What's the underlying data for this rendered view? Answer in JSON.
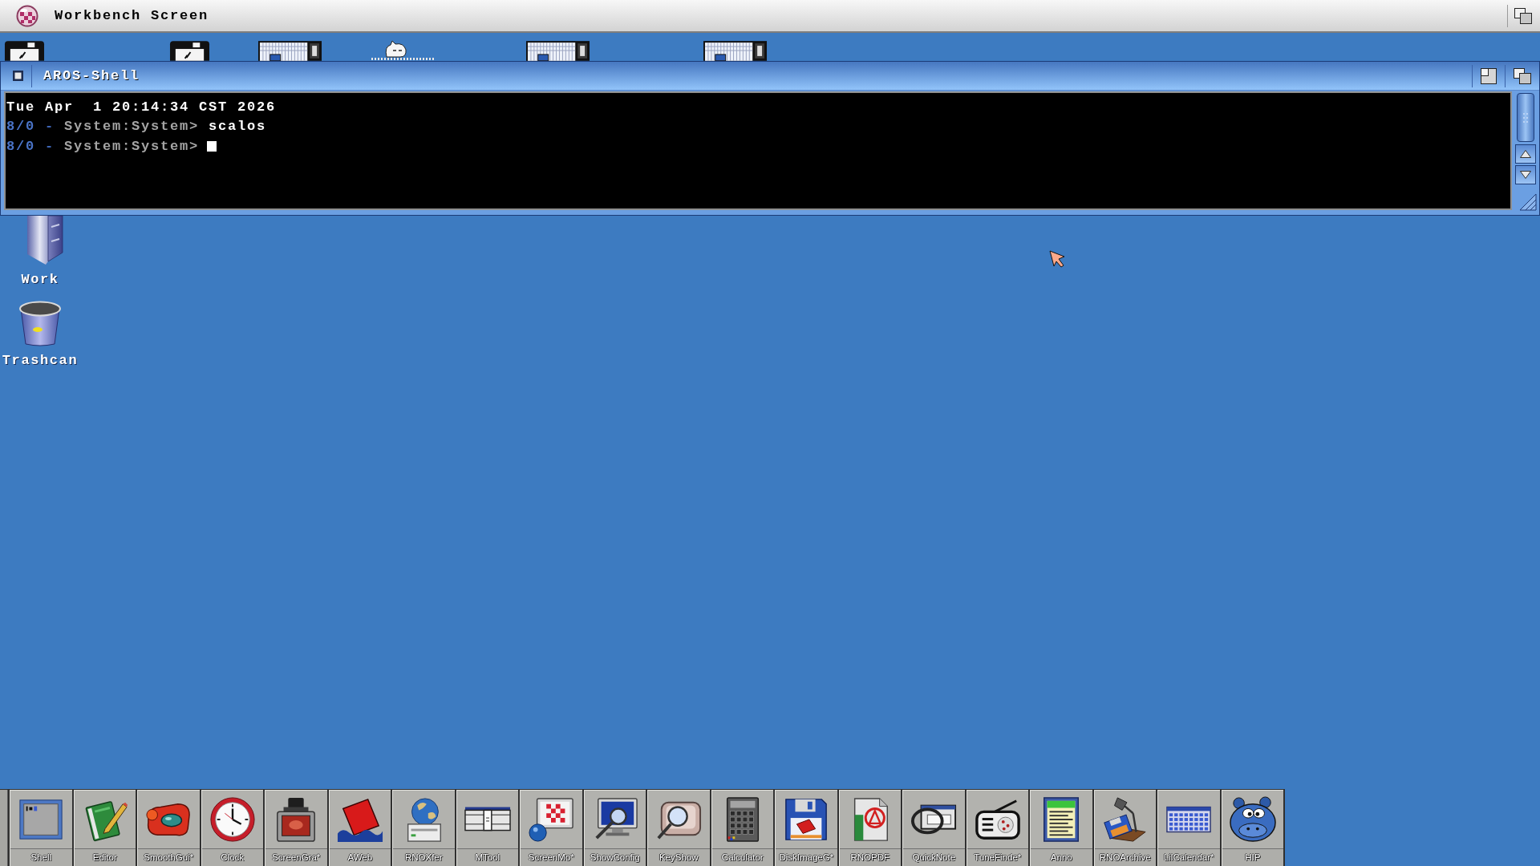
{
  "screen_title_bar": {
    "title": "Workbench Screen"
  },
  "partially_hidden_icons": [
    {
      "kind": "floppy"
    },
    {
      "kind": "floppy"
    },
    {
      "kind": "window"
    },
    {
      "kind": "cat"
    },
    {
      "kind": "window"
    },
    {
      "kind": "window"
    }
  ],
  "shell_window": {
    "title": "AROS-Shell",
    "lines": [
      {
        "segments": [
          {
            "kind": "output",
            "text": "Tue Apr  1 20:14:34 CST 2026"
          }
        ],
        "cursor": false
      },
      {
        "segments": [
          {
            "kind": "job",
            "text": "8/0"
          },
          {
            "kind": "separator",
            "text": "-"
          },
          {
            "kind": "path",
            "text": "System:System>"
          },
          {
            "kind": "command",
            "text": "scalos"
          }
        ],
        "cursor": false
      },
      {
        "segments": [
          {
            "kind": "job",
            "text": "8/0"
          },
          {
            "kind": "separator",
            "text": "-"
          },
          {
            "kind": "path",
            "text": "System:System>"
          }
        ],
        "cursor": true
      }
    ]
  },
  "desktop_icons": [
    {
      "label": "Work",
      "kind": "drawer"
    },
    {
      "label": "Trashcan",
      "kind": "trashcan"
    }
  ],
  "dock": {
    "items": [
      {
        "label": "Shell",
        "kind": "shell"
      },
      {
        "label": "Editor",
        "kind": "editor"
      },
      {
        "label": "SmoothGui*",
        "kind": "viewer"
      },
      {
        "label": "Clock",
        "kind": "clock"
      },
      {
        "label": "ScreenGra*",
        "kind": "grabber"
      },
      {
        "label": "AWeb",
        "kind": "browser"
      },
      {
        "label": "RNOXfer",
        "kind": "transfer"
      },
      {
        "label": "MTool",
        "kind": "toolbar"
      },
      {
        "label": "ScreenMo*",
        "kind": "screenmode"
      },
      {
        "label": "ShowConfig",
        "kind": "sysinfo"
      },
      {
        "label": "KeyShow",
        "kind": "keys"
      },
      {
        "label": "Calculator",
        "kind": "calculator"
      },
      {
        "label": "DiskImageG*",
        "kind": "diskimage"
      },
      {
        "label": "RNOPDF",
        "kind": "pdf"
      },
      {
        "label": "QuickNote",
        "kind": "note"
      },
      {
        "label": "TuneFinde*",
        "kind": "radio"
      },
      {
        "label": "Anno",
        "kind": "list"
      },
      {
        "label": "RNOArchive",
        "kind": "archive"
      },
      {
        "label": "LilCalendar*",
        "kind": "calendar"
      },
      {
        "label": "HIP",
        "kind": "hippo"
      }
    ]
  }
}
